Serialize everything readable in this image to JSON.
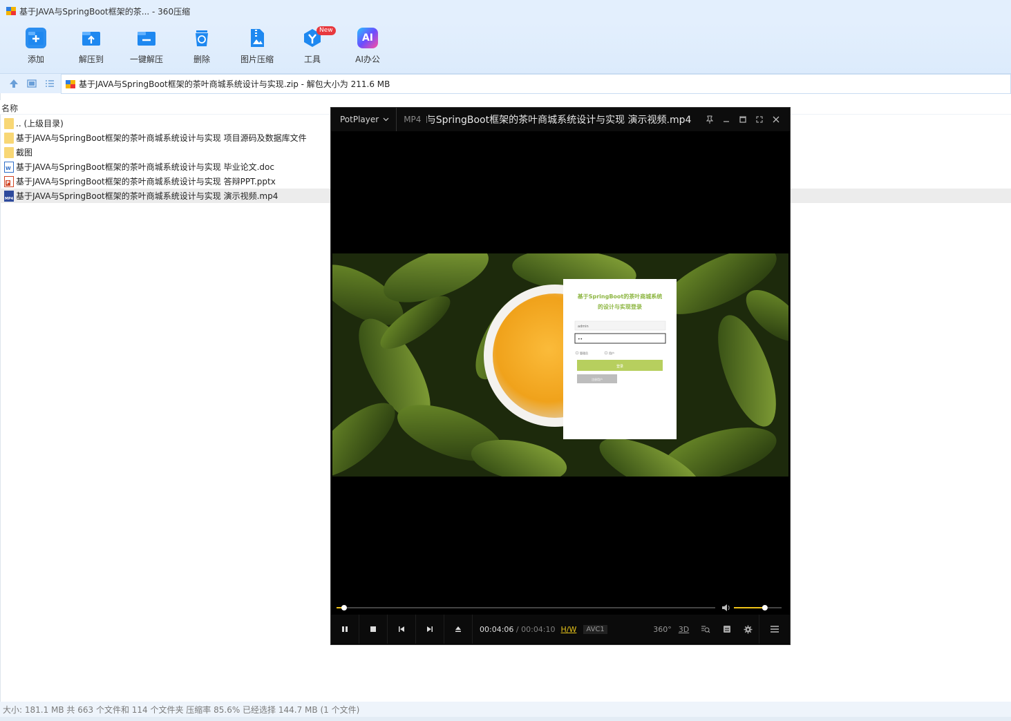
{
  "window": {
    "title": "基于JAVA与SpringBoot框架的茶... - 360压缩"
  },
  "toolbar": {
    "items": [
      {
        "label": "添加",
        "icon": "add-icon"
      },
      {
        "label": "解压到",
        "icon": "extract-to-icon"
      },
      {
        "label": "一键解压",
        "icon": "one-click-extract-icon"
      },
      {
        "label": "删除",
        "icon": "delete-icon"
      },
      {
        "label": "图片压缩",
        "icon": "image-compress-icon"
      },
      {
        "label": "工具",
        "icon": "tools-icon",
        "badge": "New"
      },
      {
        "label": "AI办公",
        "icon": "ai-office-icon",
        "glyph": "AI"
      }
    ]
  },
  "nav": {
    "path": "基于JAVA与SpringBoot框架的茶叶商城系统设计与实现.zip - 解包大小为 211.6 MB"
  },
  "list": {
    "column_name": "名称",
    "rows": [
      {
        "name": ".. (上级目录)",
        "type": "folder"
      },
      {
        "name": "基于JAVA与SpringBoot框架的茶叶商城系统设计与实现 项目源码及数据库文件",
        "type": "folder"
      },
      {
        "name": "截图",
        "type": "folder"
      },
      {
        "name": "基于JAVA与SpringBoot框架的茶叶商城系统设计与实现 毕业论文.doc",
        "type": "doc",
        "tag": "W"
      },
      {
        "name": "基于JAVA与SpringBoot框架的茶叶商城系统设计与实现 答辩PPT.pptx",
        "type": "ppt",
        "tag": "P"
      },
      {
        "name": "基于JAVA与SpringBoot框架的茶叶商城系统设计与实现 演示视频.mp4",
        "type": "mp4",
        "tag": "MP4",
        "selected": true
      }
    ]
  },
  "status": {
    "text": "大小: 181.1 MB 共 663 个文件和 114 个文件夹 压缩率 85.6% 已经选择 144.7 MB (1 个文件)"
  },
  "player": {
    "brand": "PotPlayer",
    "format": "MP4",
    "file_title": "基于JAVA与SpringBoot框架的茶叶商城系统设计与实现 演示视频.mp4",
    "current_time": "00:04:06",
    "separator": " / ",
    "total_time": "00:04:10",
    "hw": "H/W",
    "codec": "AVC1",
    "progress": 0.02,
    "volume": 0.65,
    "right_icons": [
      "360°",
      "3D"
    ],
    "video": {
      "login_title_1": "基于SpringBoot的茶叶商城系统",
      "login_title_2": "的设计与实现登录",
      "username": "admin",
      "password": "••",
      "radio_1": "管理员",
      "radio_2": "用户",
      "login_button": "登录",
      "register_button": "注册用户"
    }
  }
}
